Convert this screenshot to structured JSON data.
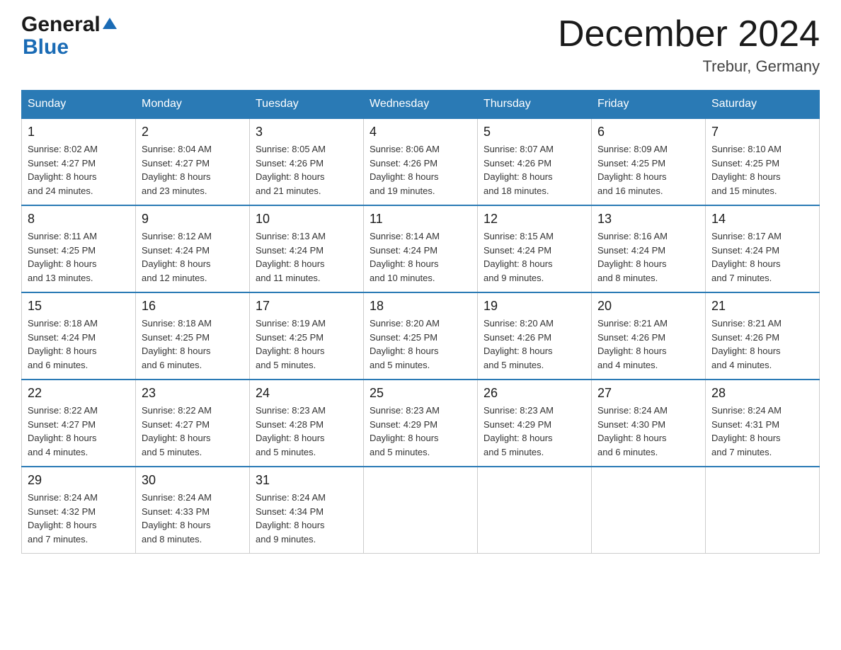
{
  "header": {
    "logo_general": "General",
    "logo_blue": "Blue",
    "month_title": "December 2024",
    "location": "Trebur, Germany"
  },
  "days_of_week": [
    "Sunday",
    "Monday",
    "Tuesday",
    "Wednesday",
    "Thursday",
    "Friday",
    "Saturday"
  ],
  "weeks": [
    [
      {
        "num": "1",
        "info": "Sunrise: 8:02 AM\nSunset: 4:27 PM\nDaylight: 8 hours\nand 24 minutes."
      },
      {
        "num": "2",
        "info": "Sunrise: 8:04 AM\nSunset: 4:27 PM\nDaylight: 8 hours\nand 23 minutes."
      },
      {
        "num": "3",
        "info": "Sunrise: 8:05 AM\nSunset: 4:26 PM\nDaylight: 8 hours\nand 21 minutes."
      },
      {
        "num": "4",
        "info": "Sunrise: 8:06 AM\nSunset: 4:26 PM\nDaylight: 8 hours\nand 19 minutes."
      },
      {
        "num": "5",
        "info": "Sunrise: 8:07 AM\nSunset: 4:26 PM\nDaylight: 8 hours\nand 18 minutes."
      },
      {
        "num": "6",
        "info": "Sunrise: 8:09 AM\nSunset: 4:25 PM\nDaylight: 8 hours\nand 16 minutes."
      },
      {
        "num": "7",
        "info": "Sunrise: 8:10 AM\nSunset: 4:25 PM\nDaylight: 8 hours\nand 15 minutes."
      }
    ],
    [
      {
        "num": "8",
        "info": "Sunrise: 8:11 AM\nSunset: 4:25 PM\nDaylight: 8 hours\nand 13 minutes."
      },
      {
        "num": "9",
        "info": "Sunrise: 8:12 AM\nSunset: 4:24 PM\nDaylight: 8 hours\nand 12 minutes."
      },
      {
        "num": "10",
        "info": "Sunrise: 8:13 AM\nSunset: 4:24 PM\nDaylight: 8 hours\nand 11 minutes."
      },
      {
        "num": "11",
        "info": "Sunrise: 8:14 AM\nSunset: 4:24 PM\nDaylight: 8 hours\nand 10 minutes."
      },
      {
        "num": "12",
        "info": "Sunrise: 8:15 AM\nSunset: 4:24 PM\nDaylight: 8 hours\nand 9 minutes."
      },
      {
        "num": "13",
        "info": "Sunrise: 8:16 AM\nSunset: 4:24 PM\nDaylight: 8 hours\nand 8 minutes."
      },
      {
        "num": "14",
        "info": "Sunrise: 8:17 AM\nSunset: 4:24 PM\nDaylight: 8 hours\nand 7 minutes."
      }
    ],
    [
      {
        "num": "15",
        "info": "Sunrise: 8:18 AM\nSunset: 4:24 PM\nDaylight: 8 hours\nand 6 minutes."
      },
      {
        "num": "16",
        "info": "Sunrise: 8:18 AM\nSunset: 4:25 PM\nDaylight: 8 hours\nand 6 minutes."
      },
      {
        "num": "17",
        "info": "Sunrise: 8:19 AM\nSunset: 4:25 PM\nDaylight: 8 hours\nand 5 minutes."
      },
      {
        "num": "18",
        "info": "Sunrise: 8:20 AM\nSunset: 4:25 PM\nDaylight: 8 hours\nand 5 minutes."
      },
      {
        "num": "19",
        "info": "Sunrise: 8:20 AM\nSunset: 4:26 PM\nDaylight: 8 hours\nand 5 minutes."
      },
      {
        "num": "20",
        "info": "Sunrise: 8:21 AM\nSunset: 4:26 PM\nDaylight: 8 hours\nand 4 minutes."
      },
      {
        "num": "21",
        "info": "Sunrise: 8:21 AM\nSunset: 4:26 PM\nDaylight: 8 hours\nand 4 minutes."
      }
    ],
    [
      {
        "num": "22",
        "info": "Sunrise: 8:22 AM\nSunset: 4:27 PM\nDaylight: 8 hours\nand 4 minutes."
      },
      {
        "num": "23",
        "info": "Sunrise: 8:22 AM\nSunset: 4:27 PM\nDaylight: 8 hours\nand 5 minutes."
      },
      {
        "num": "24",
        "info": "Sunrise: 8:23 AM\nSunset: 4:28 PM\nDaylight: 8 hours\nand 5 minutes."
      },
      {
        "num": "25",
        "info": "Sunrise: 8:23 AM\nSunset: 4:29 PM\nDaylight: 8 hours\nand 5 minutes."
      },
      {
        "num": "26",
        "info": "Sunrise: 8:23 AM\nSunset: 4:29 PM\nDaylight: 8 hours\nand 5 minutes."
      },
      {
        "num": "27",
        "info": "Sunrise: 8:24 AM\nSunset: 4:30 PM\nDaylight: 8 hours\nand 6 minutes."
      },
      {
        "num": "28",
        "info": "Sunrise: 8:24 AM\nSunset: 4:31 PM\nDaylight: 8 hours\nand 7 minutes."
      }
    ],
    [
      {
        "num": "29",
        "info": "Sunrise: 8:24 AM\nSunset: 4:32 PM\nDaylight: 8 hours\nand 7 minutes."
      },
      {
        "num": "30",
        "info": "Sunrise: 8:24 AM\nSunset: 4:33 PM\nDaylight: 8 hours\nand 8 minutes."
      },
      {
        "num": "31",
        "info": "Sunrise: 8:24 AM\nSunset: 4:34 PM\nDaylight: 8 hours\nand 9 minutes."
      },
      {
        "num": "",
        "info": ""
      },
      {
        "num": "",
        "info": ""
      },
      {
        "num": "",
        "info": ""
      },
      {
        "num": "",
        "info": ""
      }
    ]
  ]
}
